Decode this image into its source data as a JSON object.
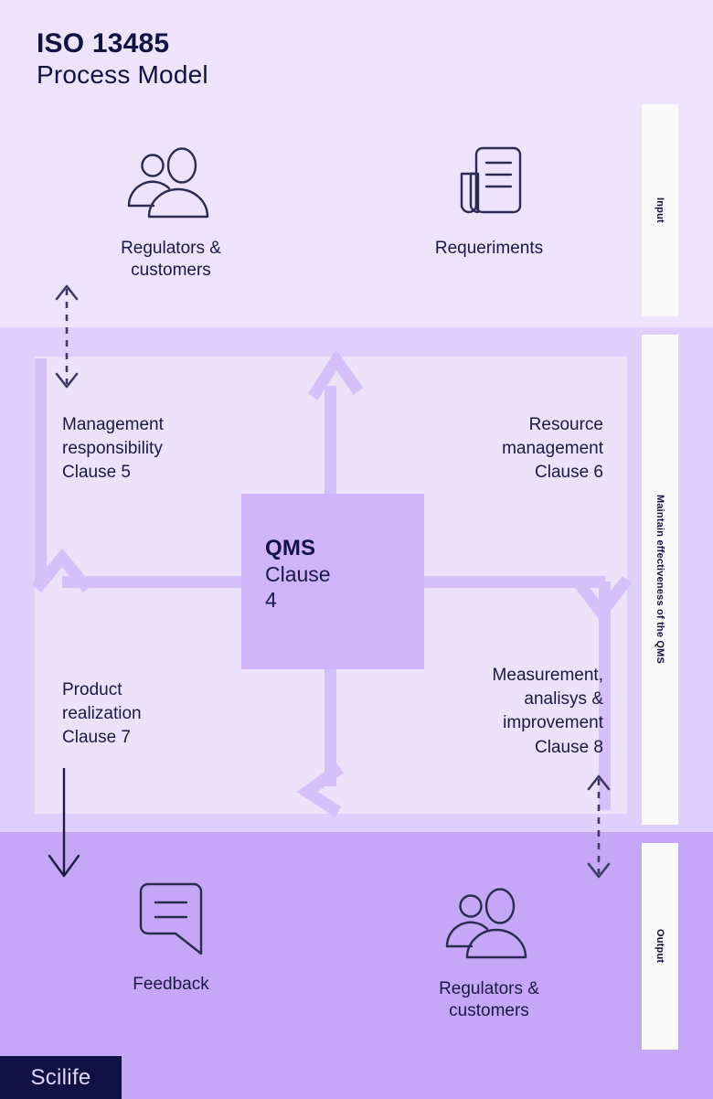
{
  "header": {
    "title_main": "ISO 13485",
    "title_sub": "Process Model"
  },
  "bands": {
    "input_label": "Input",
    "middle_label": "Maintain effectiveness of the QMS",
    "output_label": "Output"
  },
  "input_nodes": [
    {
      "icon": "people-icon",
      "caption": "Regulators &\ncustomers"
    },
    {
      "icon": "document-icon",
      "caption": "Requeriments"
    }
  ],
  "output_nodes": [
    {
      "icon": "speech-bubble-icon",
      "caption": "Feedback"
    },
    {
      "icon": "people-icon",
      "caption": "Regulators &\ncustomers"
    }
  ],
  "center": {
    "title": "QMS",
    "subtitle": "Clause\n4"
  },
  "clauses": [
    {
      "name": "Management\nresponsibility\nClause 5",
      "align": "left"
    },
    {
      "name": "Resource\nmanagement\nClause 6",
      "align": "right"
    },
    {
      "name": "Product\nrealization\nClause 7",
      "align": "left"
    },
    {
      "name": "Measurement,\nanalisys &\nimprovement\nClause 8",
      "align": "right"
    }
  ],
  "footer": {
    "logo_text": "Scilife"
  },
  "colors": {
    "band_input": "#ede4fb",
    "band_middle": "#ded0fa",
    "band_output": "#c6a7f7",
    "process_area": "#ece3fb",
    "flow": "#d5c0fa",
    "qms_box": "#cfb4fa",
    "ink": "#121144",
    "strip": "#fafafa",
    "logo_bg": "#111145",
    "logo_text": "#e2d4fb"
  }
}
